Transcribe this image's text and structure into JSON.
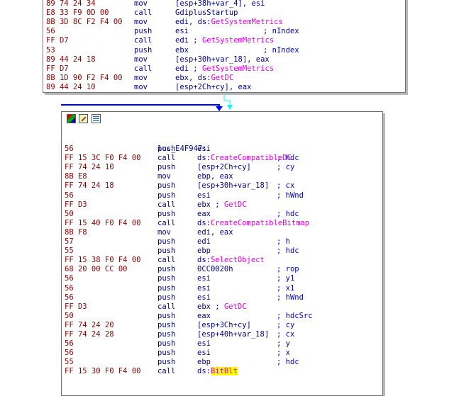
{
  "top_block": {
    "lines": [
      {
        "bytes": "89 74 24 34",
        "mnem": "mov",
        "ops": [
          {
            "t": "[esp+38h+var_4], esi"
          }
        ],
        "comment": []
      },
      {
        "bytes": "E8 33 F9 0D 00",
        "mnem": "call",
        "ops": [
          {
            "t": "GdiplusStartup"
          }
        ],
        "comment": []
      },
      {
        "bytes": "8B 3D 8C F2 F4 00",
        "mnem": "mov",
        "ops": [
          {
            "t": "edi, ds:"
          },
          {
            "t": "GetSystemMetrics",
            "api": true
          }
        ],
        "comment": []
      },
      {
        "bytes": "56",
        "mnem": "push",
        "ops": [
          {
            "t": "esi"
          }
        ],
        "comment": [
          {
            "t": "; nIndex"
          }
        ]
      },
      {
        "bytes": "FF D7",
        "mnem": "call",
        "ops": [
          {
            "t": "edi "
          },
          {
            "t": "; ",
            "semi": true
          },
          {
            "t": "GetSystemMetrics",
            "api": true
          }
        ],
        "comment": []
      },
      {
        "bytes": "53",
        "mnem": "push",
        "ops": [
          {
            "t": "ebx"
          }
        ],
        "comment": [
          {
            "t": "; nIndex"
          }
        ]
      },
      {
        "bytes": "89 44 24 18",
        "mnem": "mov",
        "ops": [
          {
            "t": "[esp+30h+var_18], eax"
          }
        ],
        "comment": []
      },
      {
        "bytes": "FF D7",
        "mnem": "call",
        "ops": [
          {
            "t": "edi "
          },
          {
            "t": "; ",
            "semi": true
          },
          {
            "t": "GetSystemMetrics",
            "api": true
          }
        ],
        "comment": []
      },
      {
        "bytes": "8B 1D 90 F2 F4 00",
        "mnem": "mov",
        "ops": [
          {
            "t": "ebx, ds:"
          },
          {
            "t": "GetDC",
            "api": true
          }
        ],
        "comment": []
      },
      {
        "bytes": "89 44 24 10",
        "mnem": "mov",
        "ops": [
          {
            "t": "[esp+2Ch+cy], eax"
          }
        ],
        "comment": []
      }
    ]
  },
  "bottom_block": {
    "label": "loc_E4F947:",
    "label_comment": "; hdc",
    "lines": [
      {
        "bytes": "56",
        "mnem": "push",
        "ops": [
          {
            "t": "esi"
          }
        ],
        "comment": []
      },
      {
        "bytes": "FF 15 3C F0 F4 00",
        "mnem": "call",
        "ops": [
          {
            "t": "ds:"
          },
          {
            "t": "CreateCompatibleDC",
            "api": true
          }
        ],
        "comment": []
      },
      {
        "bytes": "FF 74 24 10",
        "mnem": "push",
        "ops": [
          {
            "t": "[esp+2Ch+cy]"
          }
        ],
        "comment": [
          {
            "t": "; cy"
          }
        ]
      },
      {
        "bytes": "8B E8",
        "mnem": "mov",
        "ops": [
          {
            "t": "ebp, eax"
          }
        ],
        "comment": []
      },
      {
        "bytes": "FF 74 24 18",
        "mnem": "push",
        "ops": [
          {
            "t": "[esp+30h+var_18]"
          }
        ],
        "comment": [
          {
            "t": "; cx"
          }
        ]
      },
      {
        "bytes": "56",
        "mnem": "push",
        "ops": [
          {
            "t": "esi"
          }
        ],
        "comment": [
          {
            "t": "; hWnd"
          }
        ]
      },
      {
        "bytes": "FF D3",
        "mnem": "call",
        "ops": [
          {
            "t": "ebx "
          },
          {
            "t": "; ",
            "semi": true
          },
          {
            "t": "GetDC",
            "api": true
          }
        ],
        "comment": []
      },
      {
        "bytes": "50",
        "mnem": "push",
        "ops": [
          {
            "t": "eax"
          }
        ],
        "comment": [
          {
            "t": "; hdc"
          }
        ]
      },
      {
        "bytes": "FF 15 40 F0 F4 00",
        "mnem": "call",
        "ops": [
          {
            "t": "ds:"
          },
          {
            "t": "CreateCompatibleBitmap",
            "api": true
          }
        ],
        "comment": []
      },
      {
        "bytes": "8B F8",
        "mnem": "mov",
        "ops": [
          {
            "t": "edi, eax"
          }
        ],
        "comment": []
      },
      {
        "bytes": "57",
        "mnem": "push",
        "ops": [
          {
            "t": "edi"
          }
        ],
        "comment": [
          {
            "t": "; h"
          }
        ]
      },
      {
        "bytes": "55",
        "mnem": "push",
        "ops": [
          {
            "t": "ebp"
          }
        ],
        "comment": [
          {
            "t": "; hdc"
          }
        ]
      },
      {
        "bytes": "FF 15 38 F0 F4 00",
        "mnem": "call",
        "ops": [
          {
            "t": "ds:"
          },
          {
            "t": "SelectObject",
            "api": true
          }
        ],
        "comment": []
      },
      {
        "bytes": "68 20 00 CC 00",
        "mnem": "push",
        "ops": [
          {
            "t": "0CC0020h"
          }
        ],
        "comment": [
          {
            "t": "; rop"
          }
        ]
      },
      {
        "bytes": "56",
        "mnem": "push",
        "ops": [
          {
            "t": "esi"
          }
        ],
        "comment": [
          {
            "t": "; y1"
          }
        ]
      },
      {
        "bytes": "56",
        "mnem": "push",
        "ops": [
          {
            "t": "esi"
          }
        ],
        "comment": [
          {
            "t": "; x1"
          }
        ]
      },
      {
        "bytes": "56",
        "mnem": "push",
        "ops": [
          {
            "t": "esi"
          }
        ],
        "comment": [
          {
            "t": "; hWnd"
          }
        ]
      },
      {
        "bytes": "FF D3",
        "mnem": "call",
        "ops": [
          {
            "t": "ebx "
          },
          {
            "t": "; ",
            "semi": true
          },
          {
            "t": "GetDC",
            "api": true
          }
        ],
        "comment": []
      },
      {
        "bytes": "50",
        "mnem": "push",
        "ops": [
          {
            "t": "eax"
          }
        ],
        "comment": [
          {
            "t": "; hdcSrc"
          }
        ]
      },
      {
        "bytes": "FF 74 24 20",
        "mnem": "push",
        "ops": [
          {
            "t": "[esp+3Ch+cy]"
          }
        ],
        "comment": [
          {
            "t": "; cy"
          }
        ]
      },
      {
        "bytes": "FF 74 24 28",
        "mnem": "push",
        "ops": [
          {
            "t": "[esp+40h+var_18]"
          }
        ],
        "comment": [
          {
            "t": "; cx"
          }
        ]
      },
      {
        "bytes": "56",
        "mnem": "push",
        "ops": [
          {
            "t": "esi"
          }
        ],
        "comment": [
          {
            "t": "; y"
          }
        ]
      },
      {
        "bytes": "56",
        "mnem": "push",
        "ops": [
          {
            "t": "esi"
          }
        ],
        "comment": [
          {
            "t": "; x"
          }
        ]
      },
      {
        "bytes": "55",
        "mnem": "push",
        "ops": [
          {
            "t": "ebp"
          }
        ],
        "comment": [
          {
            "t": "; hdc"
          }
        ]
      },
      {
        "bytes": "FF 15 30 F0 F4 00",
        "mnem": "call",
        "ops": [
          {
            "t": "ds:"
          },
          {
            "t": "BitBlt",
            "api": true,
            "highlight": true
          }
        ],
        "comment": []
      }
    ],
    "header_icons": [
      "graph-color-icon",
      "edit-icon",
      "list-icon"
    ]
  },
  "colors": {
    "bytes": "#8b0000",
    "instruction": "#00008b",
    "api_name": "#e000e0",
    "comment": "#0000cd",
    "highlight": "#ffff00",
    "edge_true": "#0000ff",
    "edge_false": "#00ffff"
  }
}
